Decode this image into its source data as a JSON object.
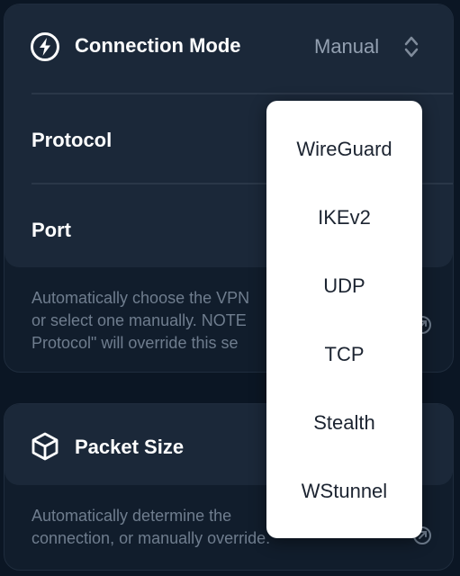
{
  "colors": {
    "background": "#0b1624",
    "card": "#111d2c",
    "card_header": "#1b2839",
    "text_primary": "#ffffff",
    "text_secondary": "#93a0b1",
    "text_muted": "#6f7d8e",
    "menu_bg": "#ffffff",
    "menu_text": "#1c2431"
  },
  "connection_card": {
    "icon": "lightning-bolt-icon",
    "title": "Connection Mode",
    "mode_value": "Manual",
    "mode_chevron_icon": "up-down-chevron-icon",
    "protocol_label": "Protocol",
    "port_label": "Port",
    "description_lines": [
      "Automatically choose the VPN",
      "or select one manually. NOTE",
      "Protocol\" will override this se"
    ],
    "info_icon": "external-link-icon"
  },
  "packet_card": {
    "icon": "cube-icon",
    "title": "Packet Size",
    "description_lines": [
      "Automatically determine the",
      "connection, or manually override."
    ],
    "info_icon": "external-link-icon"
  },
  "protocol_menu": {
    "options": [
      "WireGuard",
      "IKEv2",
      "UDP",
      "TCP",
      "Stealth",
      "WStunnel"
    ]
  }
}
